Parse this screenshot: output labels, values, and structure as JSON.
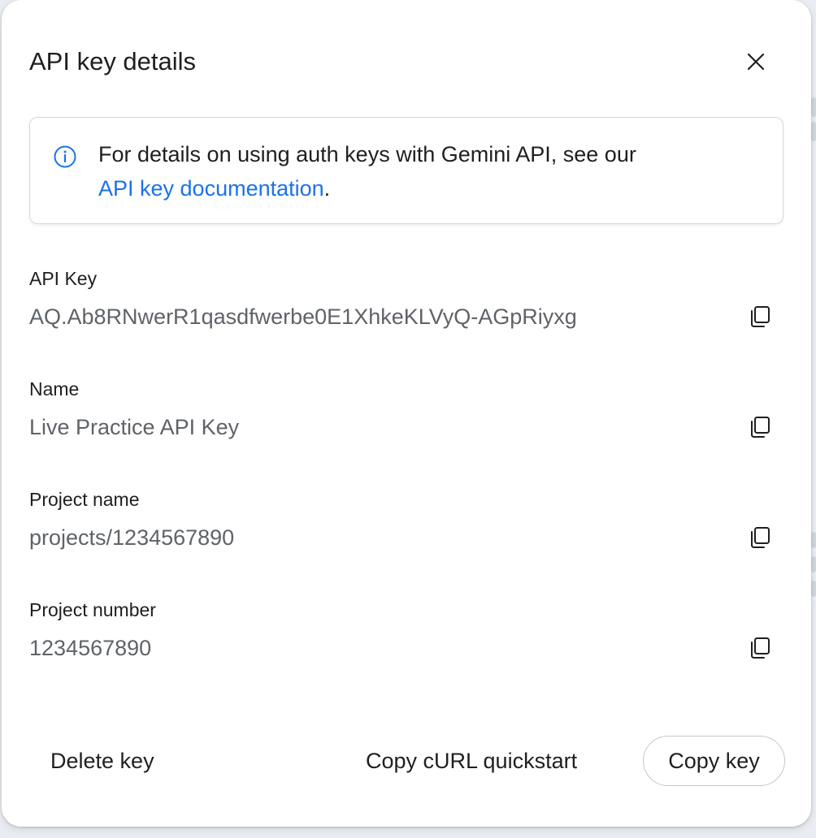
{
  "dialog": {
    "title": "API key details",
    "info": {
      "text_before": "For details on using auth keys with Gemini API, see our",
      "link_text": "API key documentation",
      "text_after": "."
    },
    "fields": [
      {
        "label": "API Key",
        "value": "AQ.Ab8RNwerR1qasdfwerbe0E1XhkeKLVyQ-AGpRiyxg"
      },
      {
        "label": "Name",
        "value": "Live Practice API Key"
      },
      {
        "label": "Project name",
        "value": "projects/1234567890"
      },
      {
        "label": "Project number",
        "value": "1234567890"
      }
    ],
    "actions": {
      "delete": "Delete key",
      "copy_curl": "Copy cURL quickstart",
      "copy_key": "Copy key"
    }
  },
  "colors": {
    "link": "#1a73e8",
    "text_primary": "#1f1f1f",
    "text_secondary": "#5f6368"
  },
  "icons": {
    "close": "close-icon",
    "info": "info-icon",
    "copy": "copy-icon"
  }
}
